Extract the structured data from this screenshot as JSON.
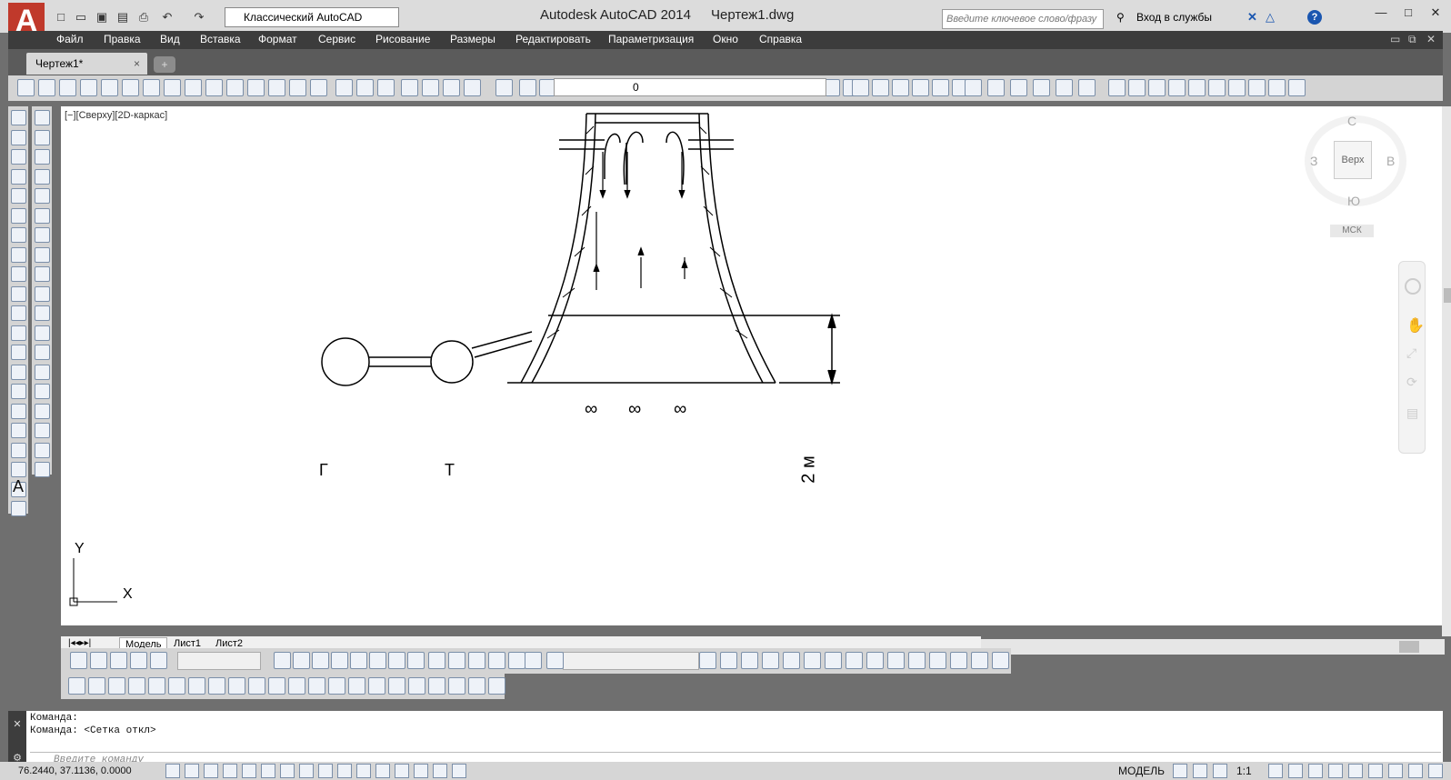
{
  "app": {
    "product_title": "Autodesk AutoCAD 2014",
    "file_title": "Чертеж1.dwg",
    "workspace": "Классический AutoCAD",
    "search_placeholder": "Введите ключевое слово/фразу",
    "signin": "Вход в службы",
    "help": "?"
  },
  "menu": [
    "Файл",
    "Правка",
    "Вид",
    "Вставка",
    "Формат",
    "Сервис",
    "Рисование",
    "Размеры",
    "Редактировать",
    "Параметризация",
    "Окно",
    "Справка"
  ],
  "tab": {
    "label": "Чертеж1*",
    "close": "×"
  },
  "layer": {
    "value": "0"
  },
  "viewport": {
    "label": "[−][Сверху][2D-каркас]",
    "axis_x": "X",
    "axis_y": "Y"
  },
  "viewcube": {
    "north": "С",
    "south": "Ю",
    "west": "З",
    "east": "В",
    "face": "Верх",
    "ucs": "МСК"
  },
  "drawing": {
    "generator_label": "Г",
    "turbine_label": "Т",
    "dimension_label": "2 м",
    "fan_symbol": "∞"
  },
  "layout_tabs": [
    "Модель",
    "Лист1",
    "Лист2"
  ],
  "command": {
    "line1": "Команда:",
    "line2": "Команда:  <Сетка откл>",
    "placeholder": "Введите команду"
  },
  "status": {
    "coords": "76.2440, 37.1136, 0.0000",
    "model": "МОДЕЛЬ",
    "scale": "1:1"
  },
  "colors": {
    "accent": "#c0392b",
    "chrome": "#3c3c3c",
    "canvas": "#ffffff"
  }
}
